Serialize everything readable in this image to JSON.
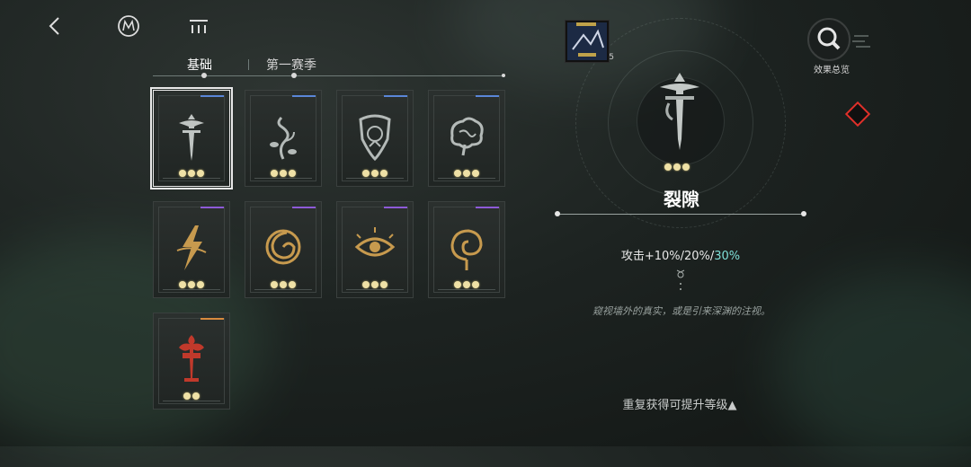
{
  "tabs": {
    "basic": "基础",
    "season": "第一赛季"
  },
  "cards": [
    {
      "name": "crack-card",
      "rarity_color": "#5a86d8",
      "pips": 3,
      "selected": true,
      "emblem_color": "#bfc4c2"
    },
    {
      "name": "vine-card",
      "rarity_color": "#5a86d8",
      "pips": 3,
      "selected": false,
      "emblem_color": "#b4bab8"
    },
    {
      "name": "shield-card",
      "rarity_color": "#5a86d8",
      "pips": 3,
      "selected": false,
      "emblem_color": "#b4bab8"
    },
    {
      "name": "brain-card",
      "rarity_color": "#5a86d8",
      "pips": 3,
      "selected": false,
      "emblem_color": "#b4bab8"
    },
    {
      "name": "lightning-card",
      "rarity_color": "#8e5ad8",
      "pips": 3,
      "selected": false,
      "emblem_color": "#c79a4e"
    },
    {
      "name": "vortex-card",
      "rarity_color": "#8e5ad8",
      "pips": 3,
      "selected": false,
      "emblem_color": "#c79a4e"
    },
    {
      "name": "eye-card",
      "rarity_color": "#8e5ad8",
      "pips": 3,
      "selected": false,
      "emblem_color": "#c79a4e"
    },
    {
      "name": "spiral-card",
      "rarity_color": "#8e5ad8",
      "pips": 3,
      "selected": false,
      "emblem_color": "#c79a4e"
    },
    {
      "name": "red-totem-card",
      "rarity_color": "#d88a3e",
      "pips": 2,
      "selected": false,
      "emblem_color": "#c0392b"
    }
  ],
  "detail": {
    "title": "裂隙",
    "stat_prefix": "攻击+10%/20%/",
    "stat_highlight": "30%",
    "flavor": "窥视墙外的真实，或是引来深渊的注视。",
    "repeat_hint": "重复获得可提升等级▲",
    "pips": 3
  },
  "top_right": {
    "search_label": "效果总览",
    "thumb_badge": "5"
  },
  "colors": {
    "accent": "#7fe0d8",
    "pip": "#efe1a6",
    "warning": "#e0302a"
  }
}
